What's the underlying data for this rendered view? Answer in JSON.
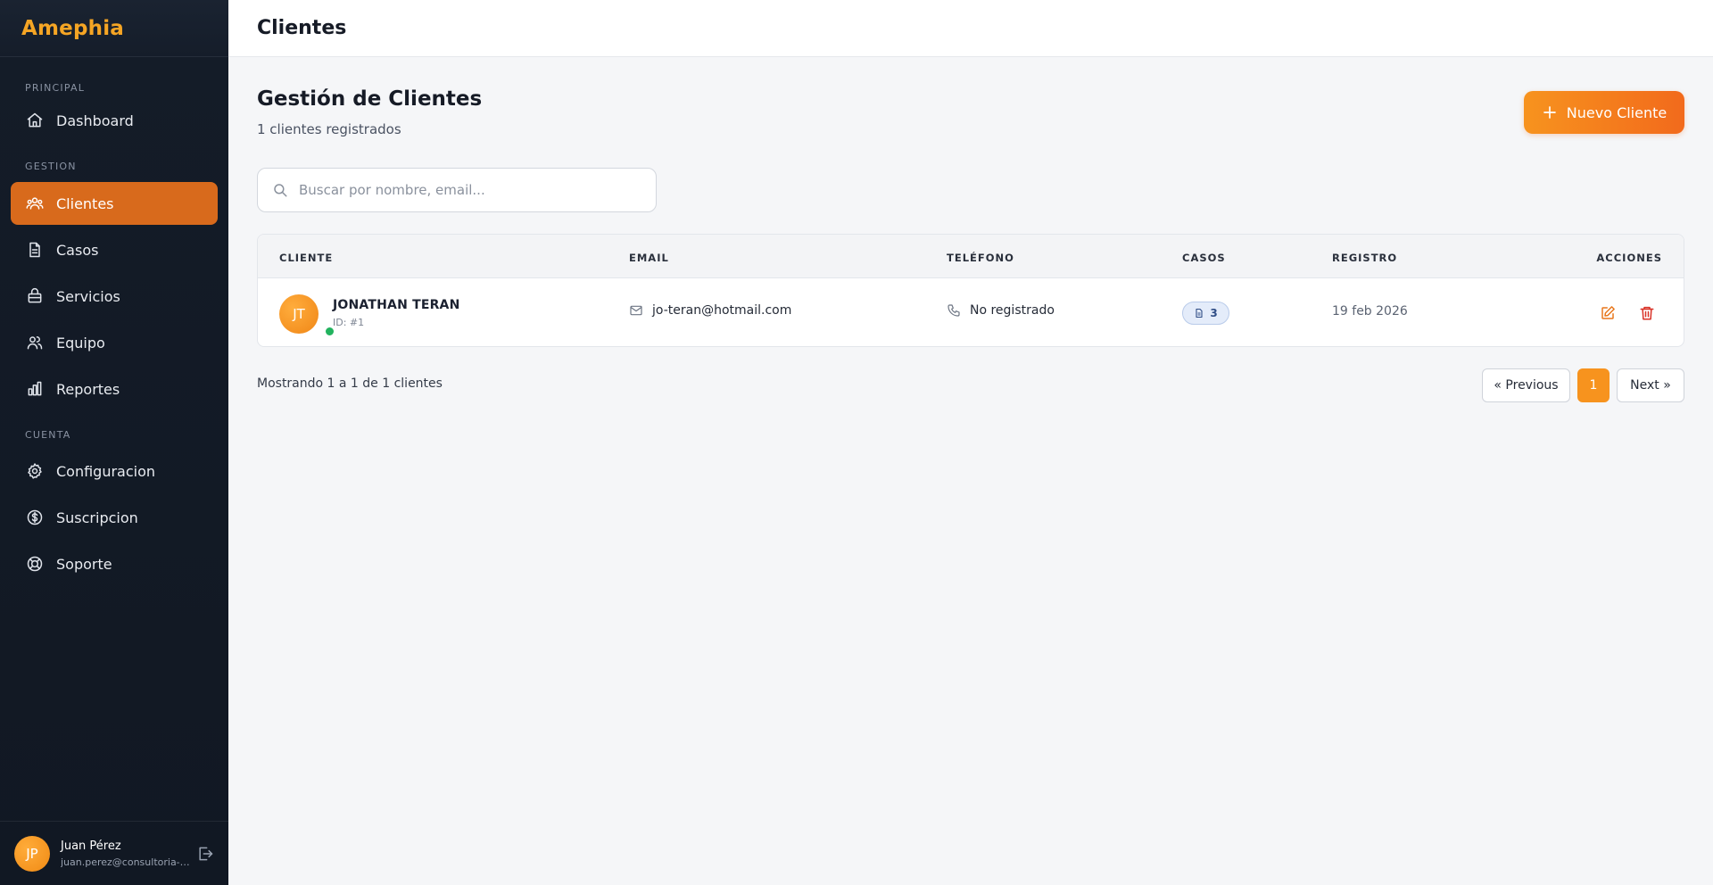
{
  "brand": {
    "name": "Amephia"
  },
  "sidebar": {
    "sections": [
      {
        "title": "PRINCIPAL"
      },
      {
        "title": "GESTION"
      },
      {
        "title": "CUENTA"
      }
    ],
    "items": [
      {
        "label": "Dashboard",
        "icon": "home-icon"
      },
      {
        "label": "Clientes",
        "icon": "users-icon"
      },
      {
        "label": "Casos",
        "icon": "document-icon"
      },
      {
        "label": "Servicios",
        "icon": "briefcase-icon"
      },
      {
        "label": "Equipo",
        "icon": "team-icon"
      },
      {
        "label": "Reportes",
        "icon": "bar-chart-icon"
      },
      {
        "label": "Configuracion",
        "icon": "gear-icon"
      },
      {
        "label": "Suscripcion",
        "icon": "dollar-icon"
      },
      {
        "label": "Soporte",
        "icon": "lifebuoy-icon"
      }
    ],
    "active_item": "Clientes"
  },
  "user": {
    "initials": "JP",
    "name": "Juan Pérez",
    "email": "juan.perez@consultoria-a..."
  },
  "topbar": {
    "title": "Clientes"
  },
  "main": {
    "title": "Gestión de Clientes",
    "subtitle": "1 clientes registrados",
    "new_button": "Nuevo Cliente",
    "search_placeholder": "Buscar por nombre, email..."
  },
  "table": {
    "headers": {
      "cliente": "CLIENTE",
      "email": "EMAIL",
      "telefono": "TELÉFONO",
      "casos": "CASOS",
      "registro": "REGISTRO",
      "acciones": "ACCIONES"
    },
    "rows": [
      {
        "initials": "JT",
        "name": "JONATHAN TERAN",
        "id": "ID: #1",
        "email": "jo-teran@hotmail.com",
        "phone": "No registrado",
        "cases": "3",
        "date": "19 feb 2026"
      }
    ]
  },
  "pagination": {
    "summary": "Mostrando 1 a 1 de 1 clientes",
    "previous": "« Previous",
    "current": "1",
    "next": "Next »"
  },
  "colors": {
    "accent": "#f7931e",
    "active_nav": "#d86a1c",
    "danger": "#d93025",
    "online": "#22b35e",
    "sidebar_bg": "#141c28"
  }
}
